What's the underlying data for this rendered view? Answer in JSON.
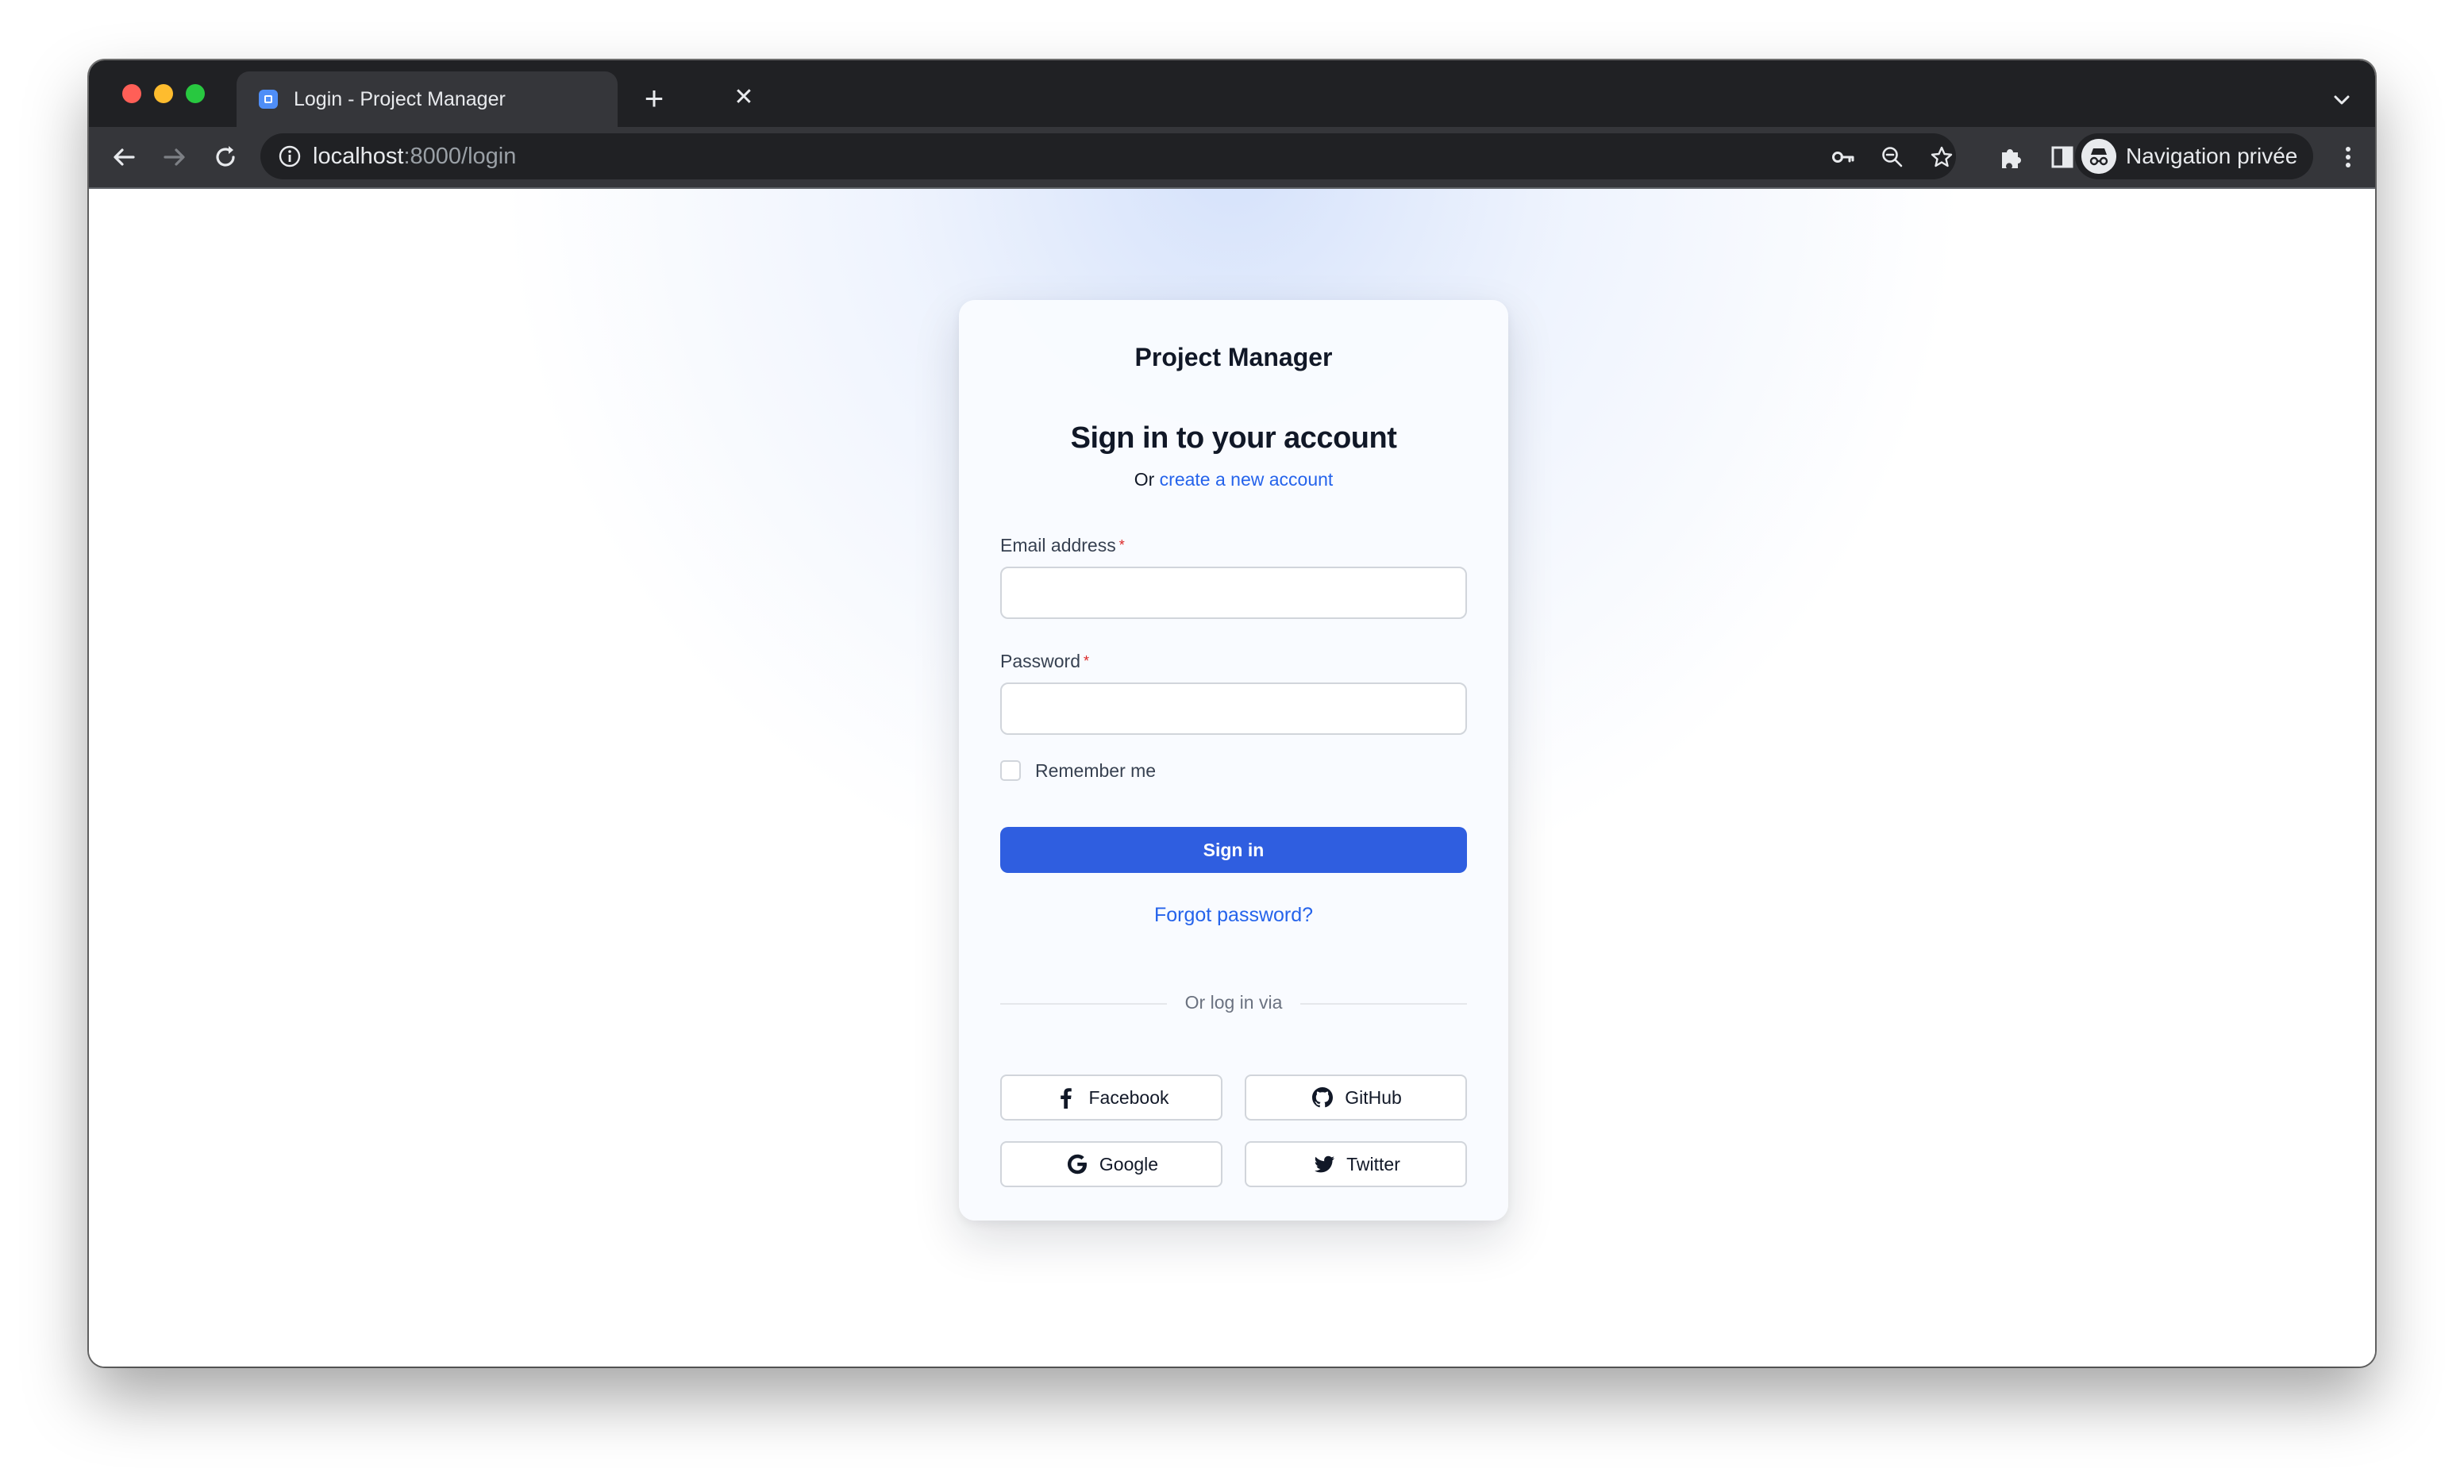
{
  "browser": {
    "tab_title": "Login - Project Manager",
    "url_host": "localhost",
    "url_rest": ":8000/login",
    "profile_label": "Navigation privée"
  },
  "page": {
    "brand": "Project Manager",
    "heading": "Sign in to your account",
    "subline_prefix": "Or",
    "create_account_link": "create a new account",
    "email_label": "Email address",
    "password_label": "Password",
    "required_mark": "*",
    "email_value": "",
    "password_value": "",
    "remember_label": "Remember me",
    "remember_checked": false,
    "signin_label": "Sign in",
    "forgot_label": "Forgot password?",
    "divider_label": "Or log in via",
    "social": {
      "facebook": "Facebook",
      "github": "GitHub",
      "google": "Google",
      "twitter": "Twitter"
    }
  },
  "colors": {
    "accent": "#2f5ee0",
    "link": "#2563eb",
    "chrome_dark": "#202124",
    "chrome_mid": "#35363a"
  }
}
